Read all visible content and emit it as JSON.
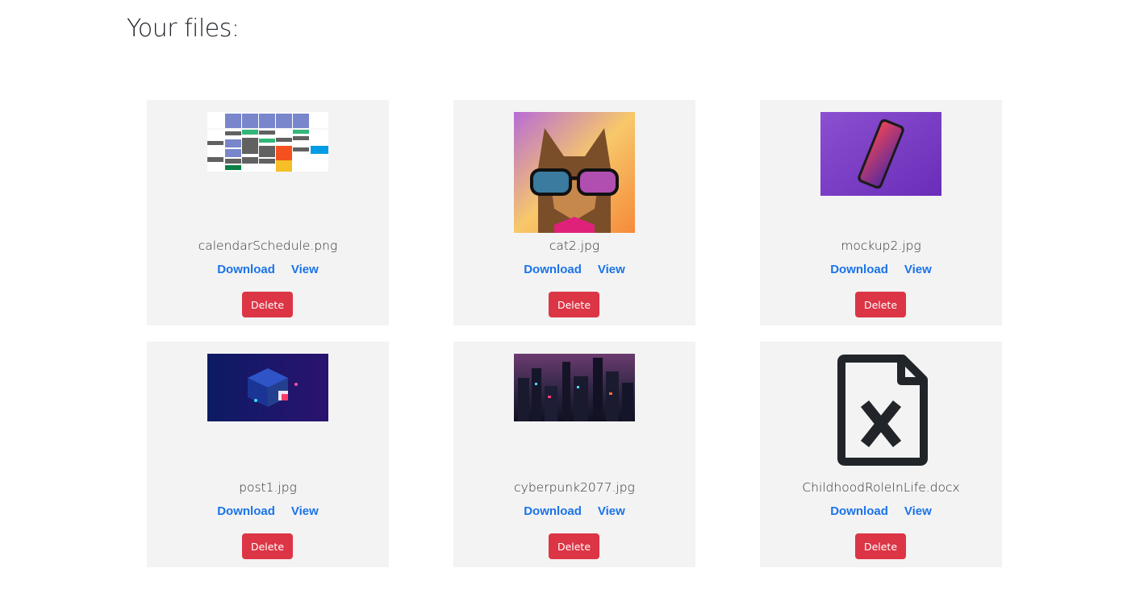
{
  "page": {
    "title": "Your files:"
  },
  "files": [
    {
      "name": "calendarSchedule.png",
      "download_label": "Download",
      "view_label": "View",
      "delete_label": "Delete",
      "thumbnail": "calendar-thumbnail"
    },
    {
      "name": "cat2.jpg",
      "download_label": "Download",
      "view_label": "View",
      "delete_label": "Delete",
      "thumbnail": "cat-thumbnail"
    },
    {
      "name": "mockup2.jpg",
      "download_label": "Download",
      "view_label": "View",
      "delete_label": "Delete",
      "thumbnail": "phone-mockup-thumbnail"
    },
    {
      "name": "post1.jpg",
      "download_label": "Download",
      "view_label": "View",
      "delete_label": "Delete",
      "thumbnail": "isometric-tech-thumbnail"
    },
    {
      "name": "cyberpunk2077.jpg",
      "download_label": "Download",
      "view_label": "View",
      "delete_label": "Delete",
      "thumbnail": "cyberpunk-city-thumbnail"
    },
    {
      "name": "ChildhoodRoleInLife.docx",
      "download_label": "Download",
      "view_label": "View",
      "delete_label": "Delete",
      "thumbnail": "document-file-icon"
    }
  ],
  "colors": {
    "link": "#1a73e8",
    "delete": "#dc3545",
    "card_bg": "#f3f3f3"
  }
}
